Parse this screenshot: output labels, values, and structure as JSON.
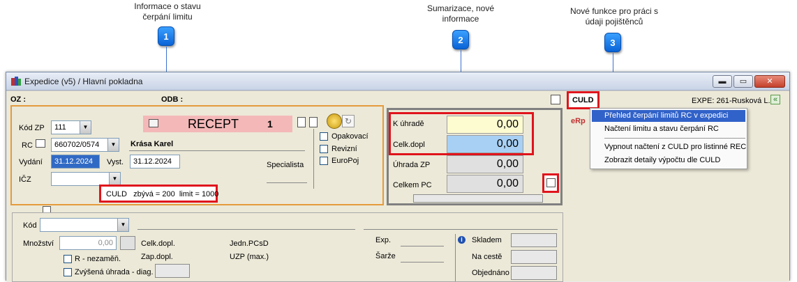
{
  "annotations": [
    {
      "number": "1",
      "text_line1": "Informace o stavu",
      "text_line2": "čerpání limitu"
    },
    {
      "number": "2",
      "text_line1": "Sumarizace, nové",
      "text_line2": "informace"
    },
    {
      "number": "3",
      "text_line1": "Nové funkce pro práci s",
      "text_line2": "údaji pojištěnců"
    }
  ],
  "window": {
    "title": "Expedice (v5) / Hlavní pokladna",
    "minimize": "▬",
    "maximize": "▭",
    "close": "✕"
  },
  "header": {
    "oz_label": "OZ :",
    "odb_label": "ODB :",
    "culd_button": "CULD",
    "expe_text": "EXPE: 261-Rusková L.",
    "expand_icon": "«"
  },
  "form": {
    "kod_zp_label": "Kód ZP",
    "kod_zp_value": "111",
    "rc_label": "RC",
    "rc_value": "660702/0574",
    "patient_name": "Krása Karel",
    "vydani_label": "Vydání",
    "vydani_value": "31.12.2024",
    "vyst_label": "Vyst.",
    "vyst_value": "31.12.2024",
    "icz_label": "IČZ",
    "icz_value": "",
    "specialista_label": "Specialista",
    "recept_label": "RECEPT",
    "recept_number": "1",
    "opakovaci_label": "Opakovací",
    "revizni_label": "Revizní",
    "europoj_label": "EuroPoj",
    "culd_status": "CULD   zbývá = 200  limit = 1000"
  },
  "summary": {
    "k_uhrade_label": "K úhradě",
    "k_uhrade_value": "0,00",
    "celk_dopl_label": "Celk.dopl",
    "celk_dopl_value": "0,00",
    "uhrada_zp_label": "Úhrada ZP",
    "uhrada_zp_value": "0,00",
    "celkem_pc_label": "Celkem PC",
    "celkem_pc_value": "0,00"
  },
  "culd_menu": {
    "erp_label": "eRp",
    "items": [
      "Přehled čerpání limitů RC v expedici",
      "Načtení limitu a stavu čerpání RC",
      "Vypnout načtení z CULD pro listinné REC",
      "Zobrazit detaily výpočtu dle CULD"
    ]
  },
  "lower": {
    "kod_label": "Kód",
    "mnozstvi_label": "Množství",
    "mnozstvi_value": "0,00",
    "celk_dopl_label": "Celk.dopl.",
    "zap_dopl_label": "Zap.dopl.",
    "jedn_pcsd_label": "Jedn.PCsD",
    "uzp_max_label": "UZP (max.)",
    "exp_label": "Exp.",
    "sarze_label": "Šarže",
    "r_nezamen_label": "R - nezaměň.",
    "zvysena_label": "Zvýšená úhrada - diag.",
    "skladem_label": "Skladem",
    "na_ceste_label": "Na cestě",
    "objednano_label": "Objednáno",
    "info_icon": "i"
  }
}
